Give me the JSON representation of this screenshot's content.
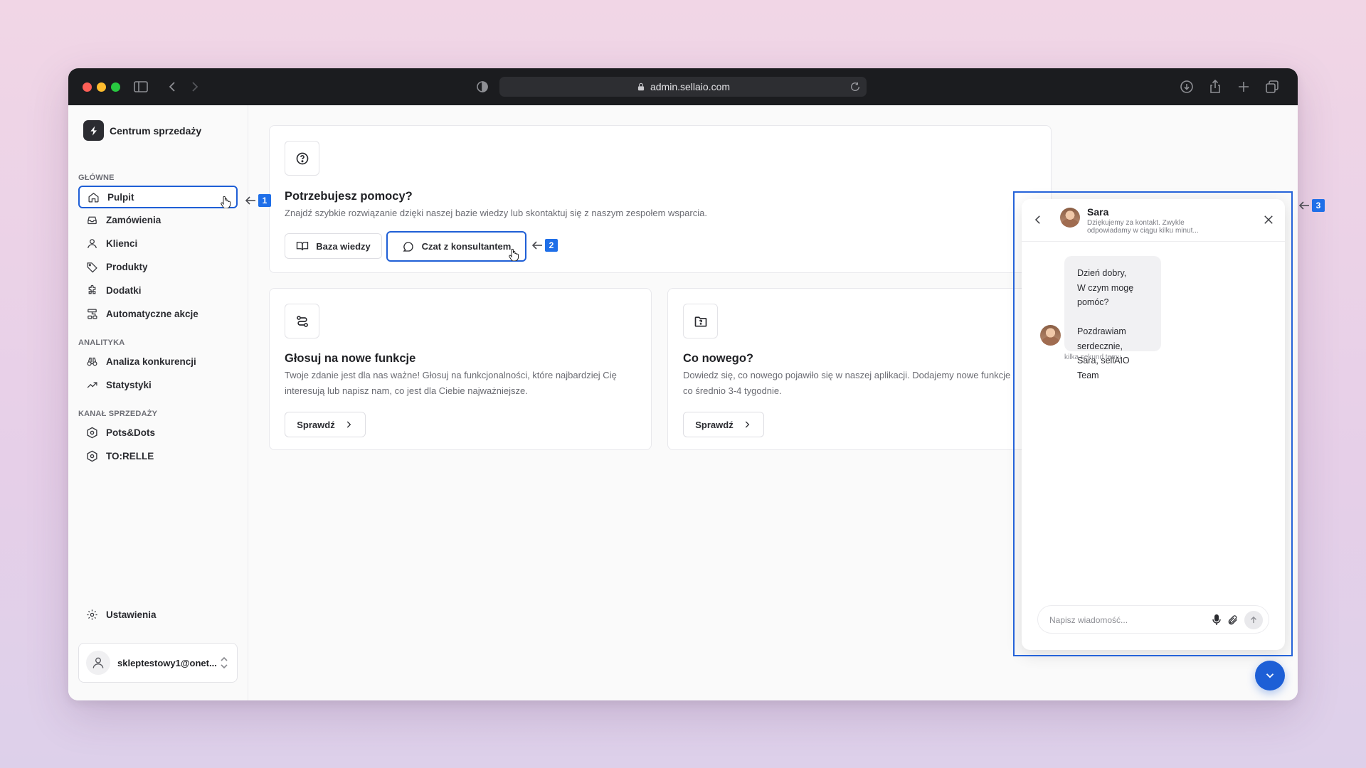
{
  "browser": {
    "url": "admin.sellaio.com"
  },
  "brand": {
    "name": "Centrum sprzedaży"
  },
  "sidebar": {
    "sections": [
      {
        "label": "GŁÓWNE",
        "items": [
          {
            "label": "Pulpit",
            "icon": "home-icon",
            "active": true
          },
          {
            "label": "Zamówienia",
            "icon": "inbox-icon"
          },
          {
            "label": "Klienci",
            "icon": "user-icon"
          },
          {
            "label": "Produkty",
            "icon": "tag-icon"
          },
          {
            "label": "Dodatki",
            "icon": "puzzle-icon"
          },
          {
            "label": "Automatyczne akcje",
            "icon": "workflow-icon"
          }
        ]
      },
      {
        "label": "ANALITYKA",
        "items": [
          {
            "label": "Analiza konkurencji",
            "icon": "binoculars-icon"
          },
          {
            "label": "Statystyki",
            "icon": "trending-up-icon"
          }
        ]
      },
      {
        "label": "KANAŁ SPRZEDAŻY",
        "items": [
          {
            "label": "Pots&Dots",
            "icon": "hexagon-icon"
          },
          {
            "label": "TO:RELLE",
            "icon": "hexagon-icon"
          }
        ]
      }
    ],
    "settings_label": "Ustawienia",
    "user_email": "skleptestowy1@onet..."
  },
  "help_card": {
    "title": "Potrzebujesz pomocy?",
    "description": "Znajdź szybkie rozwiązanie dzięki naszej bazie wiedzy lub skontaktuj się z naszym zespołem wsparcia.",
    "knowledge_button": "Baza wiedzy",
    "chat_button": "Czat z konsultantem"
  },
  "vote_card": {
    "title": "Głosuj na nowe funkcje",
    "description_line1": "Twoje zdanie jest dla nas ważne! Głosuj na funkcjonalności, które najbardziej Cię",
    "description_line2": "interesują lub napisz nam, co jest dla Ciebie najważniejsze.",
    "button": "Sprawdź"
  },
  "news_card": {
    "title": "Co nowego?",
    "description_line1": "Dowiedz się, co nowego pojawiło się w naszej aplikacji. Dodajemy nowe funkcje",
    "description_line2": "co średnio 3-4 tygodnie.",
    "button": "Sprawdź"
  },
  "annotations": [
    "1",
    "2",
    "3"
  ],
  "chat": {
    "agent_name": "Sara",
    "agent_subtitle": "Dziękujemy za kontakt. Zwykle odpowiadamy w ciągu kilku minut...",
    "message_lines": [
      "Dzień dobry,",
      "W czym mogę pomóc?",
      "",
      "Pozdrawiam serdecznie,",
      "Sara, sellAIO Team"
    ],
    "message_time": "kilka sekund temu",
    "input_placeholder": "Napisz wiadomość..."
  },
  "colors": {
    "accent": "#1f5fd6",
    "annotation_badge": "#1f6fe8",
    "titlebar": "#1b1c1f"
  }
}
